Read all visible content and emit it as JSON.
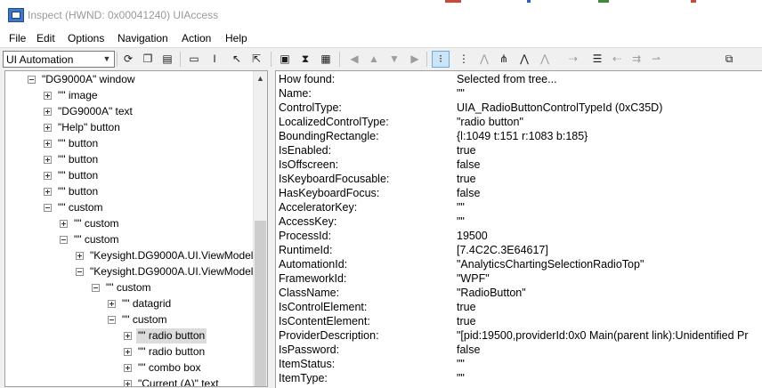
{
  "window": {
    "title": "Inspect  (HWND: 0x00041240) UIAccess"
  },
  "menu": [
    "File",
    "Edit",
    "Options",
    "Navigation",
    "Action",
    "Help"
  ],
  "toolbar": {
    "mode": "UI Automation",
    "buttons": [
      {
        "name": "refresh-icon",
        "glyph": "⟳",
        "dim": false
      },
      {
        "name": "copy-icon",
        "glyph": "❐",
        "dim": false
      },
      {
        "name": "properties-icon",
        "glyph": "▤",
        "dim": false
      },
      {
        "name": "select-rect-icon",
        "glyph": "▭",
        "dim": false
      },
      {
        "name": "caret-icon",
        "glyph": "I",
        "dim": false
      },
      {
        "name": "pointer-icon",
        "glyph": "↖",
        "dim": false
      },
      {
        "name": "focus-pointer-icon",
        "glyph": "⇱",
        "dim": false
      },
      {
        "name": "highlight-icon",
        "glyph": "▣",
        "dim": false
      },
      {
        "name": "hourglass-icon",
        "glyph": "⧗",
        "dim": false
      },
      {
        "name": "watch-icon",
        "glyph": "▦",
        "dim": false
      },
      {
        "name": "nav-left-icon",
        "glyph": "◀",
        "dim": true
      },
      {
        "name": "nav-up-icon",
        "glyph": "▲",
        "dim": true
      },
      {
        "name": "nav-down-icon",
        "glyph": "▼",
        "dim": true
      },
      {
        "name": "nav-right-icon",
        "glyph": "▶",
        "dim": true
      },
      {
        "name": "tree-view-icon",
        "glyph": "⁝",
        "dim": false,
        "sel": true
      },
      {
        "name": "parent-icon",
        "glyph": "⋮",
        "dim": false
      },
      {
        "name": "first-child-icon",
        "glyph": "⋀",
        "dim": true
      },
      {
        "name": "next-sibling-icon",
        "glyph": "⋔",
        "dim": false
      },
      {
        "name": "prev-sibling-icon",
        "glyph": "⋀",
        "dim": false
      },
      {
        "name": "last-child-icon",
        "glyph": "⋀",
        "dim": true
      },
      {
        "name": "expand-icon",
        "glyph": "⇢",
        "dim": true
      },
      {
        "name": "action-icon",
        "glyph": "☰",
        "dim": false
      },
      {
        "name": "collapse-icon",
        "glyph": "⇠",
        "dim": true
      },
      {
        "name": "move-icon",
        "glyph": "⇉",
        "dim": true
      },
      {
        "name": "scroll-icon",
        "glyph": "⇀",
        "dim": true
      },
      {
        "name": "toggle-icon",
        "glyph": "⧉",
        "dim": false
      }
    ]
  },
  "tree": [
    {
      "label": "\"DG9000A\" window",
      "indent": 0,
      "exp": "minus"
    },
    {
      "label": "\"\" image",
      "indent": 1,
      "exp": "plus"
    },
    {
      "label": "\"DG9000A\" text",
      "indent": 1,
      "exp": "plus"
    },
    {
      "label": "\"Help\" button",
      "indent": 1,
      "exp": "plus"
    },
    {
      "label": "\"\" button",
      "indent": 1,
      "exp": "plus"
    },
    {
      "label": "\"\" button",
      "indent": 1,
      "exp": "plus"
    },
    {
      "label": "\"\" button",
      "indent": 1,
      "exp": "plus"
    },
    {
      "label": "\"\" button",
      "indent": 1,
      "exp": "plus"
    },
    {
      "label": "\"\" custom",
      "indent": 1,
      "exp": "minus"
    },
    {
      "label": "\"\" custom",
      "indent": 2,
      "exp": "plus"
    },
    {
      "label": "\"\" custom",
      "indent": 2,
      "exp": "minus"
    },
    {
      "label": "\"Keysight.DG9000A.UI.ViewModel",
      "indent": 3,
      "exp": "plus"
    },
    {
      "label": "\"Keysight.DG9000A.UI.ViewModel",
      "indent": 3,
      "exp": "minus"
    },
    {
      "label": "\"\" custom",
      "indent": 4,
      "exp": "minus"
    },
    {
      "label": "\"\" datagrid",
      "indent": 5,
      "exp": "plus"
    },
    {
      "label": "\"\" custom",
      "indent": 5,
      "exp": "minus"
    },
    {
      "label": "\"\" radio button",
      "indent": 6,
      "exp": "plus",
      "selected": true
    },
    {
      "label": "\"\" radio button",
      "indent": 6,
      "exp": "plus"
    },
    {
      "label": "\"\" combo box",
      "indent": 6,
      "exp": "plus"
    },
    {
      "label": "\"Current (A)\" text",
      "indent": 6,
      "exp": "plus"
    }
  ],
  "properties": [
    {
      "name": "How found:",
      "value": "Selected from tree..."
    },
    {
      "name": "Name:",
      "value": "\"\""
    },
    {
      "name": "ControlType:",
      "value": "UIA_RadioButtonControlTypeId (0xC35D)"
    },
    {
      "name": "LocalizedControlType:",
      "value": "\"radio button\""
    },
    {
      "name": "BoundingRectangle:",
      "value": "{l:1049 t:151 r:1083 b:185}"
    },
    {
      "name": "IsEnabled:",
      "value": "true"
    },
    {
      "name": "IsOffscreen:",
      "value": "false"
    },
    {
      "name": "IsKeyboardFocusable:",
      "value": "true"
    },
    {
      "name": "HasKeyboardFocus:",
      "value": "false"
    },
    {
      "name": "AcceleratorKey:",
      "value": "\"\""
    },
    {
      "name": "AccessKey:",
      "value": "\"\""
    },
    {
      "name": "ProcessId:",
      "value": "19500"
    },
    {
      "name": "RuntimeId:",
      "value": "[7.4C2C.3E64617]"
    },
    {
      "name": "AutomationId:",
      "value": "\"AnalyticsChartingSelectionRadioTop\""
    },
    {
      "name": "FrameworkId:",
      "value": "\"WPF\""
    },
    {
      "name": "ClassName:",
      "value": "\"RadioButton\""
    },
    {
      "name": "IsControlElement:",
      "value": "true"
    },
    {
      "name": "IsContentElement:",
      "value": "true"
    },
    {
      "name": "ProviderDescription:",
      "value": "\"[pid:19500,providerId:0x0 Main(parent link):Unidentified Pr"
    },
    {
      "name": "IsPassword:",
      "value": "false"
    },
    {
      "name": "ItemStatus:",
      "value": "\"\""
    },
    {
      "name": "ItemType:",
      "value": "\"\""
    }
  ]
}
